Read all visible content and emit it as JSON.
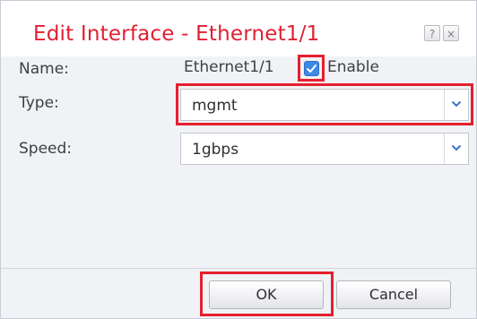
{
  "dialog": {
    "title": "Edit Interface - Ethernet1/1",
    "help_icon": "?",
    "close_icon": "×"
  },
  "form": {
    "name_label": "Name:",
    "name_value": "Ethernet1/1",
    "enable_label": "Enable",
    "enable_checked": true,
    "type_label": "Type:",
    "type_value": "mgmt",
    "speed_label": "Speed:",
    "speed_value": "1gbps"
  },
  "buttons": {
    "ok_label": "OK",
    "cancel_label": "Cancel"
  },
  "colors": {
    "title_red": "#e02033",
    "highlight_red": "#e5202e",
    "checkbox_blue": "#3d8ae6"
  },
  "icons": [
    "help-icon",
    "close-icon",
    "checkmark-icon",
    "chevron-down-icon"
  ]
}
